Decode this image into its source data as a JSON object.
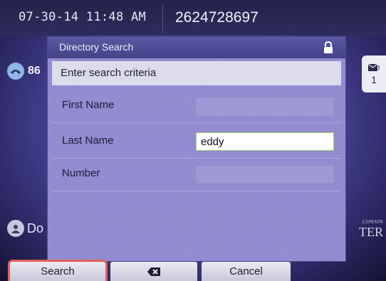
{
  "status_bar": {
    "datetime": "07-30-14 11:48 AM",
    "phone_number": "2624728697"
  },
  "background": {
    "line_key_label": "86",
    "contact_item_label": "Do",
    "message_count": "1",
    "brand_line1": "CONSIN",
    "brand_line2": "TER"
  },
  "dialog": {
    "title": "Directory Search",
    "instruction": "Enter search criteria",
    "fields": [
      {
        "label": "First Name",
        "value": ""
      },
      {
        "label": "Last Name",
        "value": "eddy"
      },
      {
        "label": "Number",
        "value": ""
      }
    ]
  },
  "softkeys": {
    "search_label": "Search",
    "backspace_icon": "backspace-icon",
    "cancel_label": "Cancel"
  },
  "colors": {
    "selected_softkey_outline": "#e45f59",
    "active_field_border": "#9bd06b",
    "dialog_bg": "#8d89cf"
  }
}
